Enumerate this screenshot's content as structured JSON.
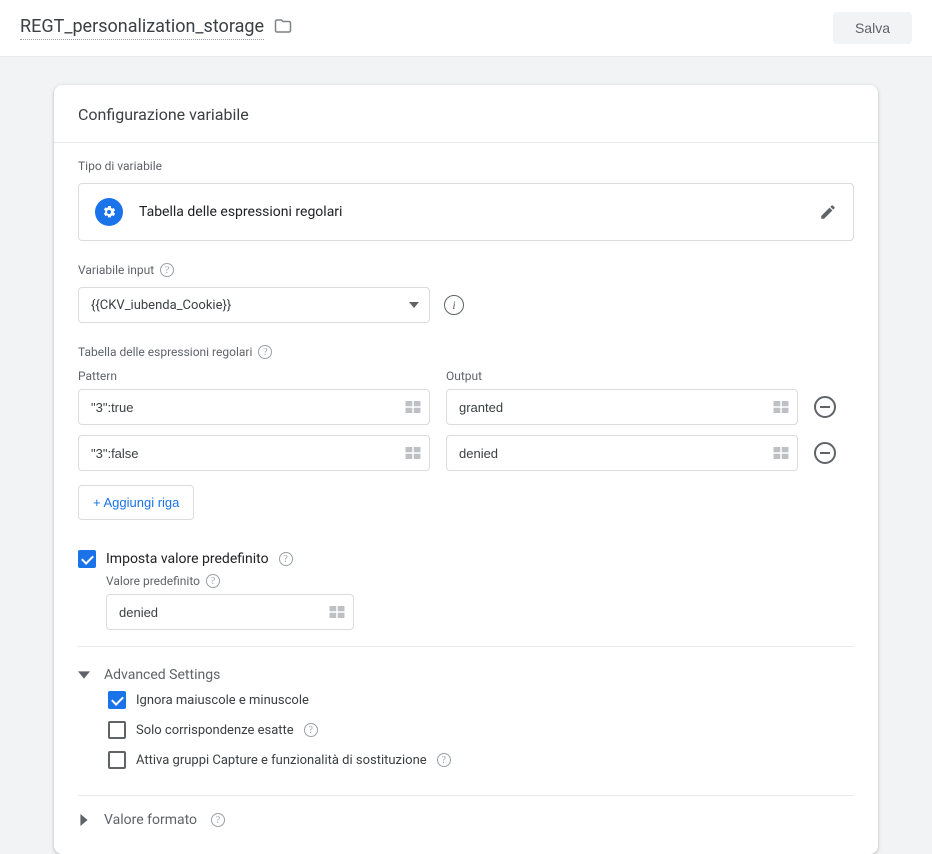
{
  "header": {
    "title": "REGT_personalization_storage",
    "save_label": "Salva"
  },
  "card": {
    "title": "Configurazione variabile",
    "type_section_label": "Tipo di variabile",
    "type_name": "Tabella delle espressioni regolari",
    "input_var_label": "Variabile input",
    "input_var_value": "{{CKV_iubenda_Cookie}}",
    "table_label": "Tabella delle espressioni regolari",
    "pattern_header": "Pattern",
    "output_header": "Output",
    "rows": [
      {
        "pattern": "\"3\":true",
        "output": "granted"
      },
      {
        "pattern": "\"3\":false",
        "output": "denied"
      }
    ],
    "add_row_label": "+ Aggiungi riga",
    "set_default_label": "Imposta valore predefinito",
    "default_label": "Valore predefinito",
    "default_value": "denied",
    "advanced_label": "Advanced Settings",
    "adv_options": {
      "ignore_case": {
        "label": "Ignora maiuscole e minuscole",
        "checked": true
      },
      "exact_match": {
        "label": "Solo corrispondenze esatte",
        "checked": false
      },
      "capture_groups": {
        "label": "Attiva gruppi Capture e funzionalità di sostituzione",
        "checked": false
      }
    },
    "format_label": "Valore formato",
    "set_default_checked": true
  }
}
